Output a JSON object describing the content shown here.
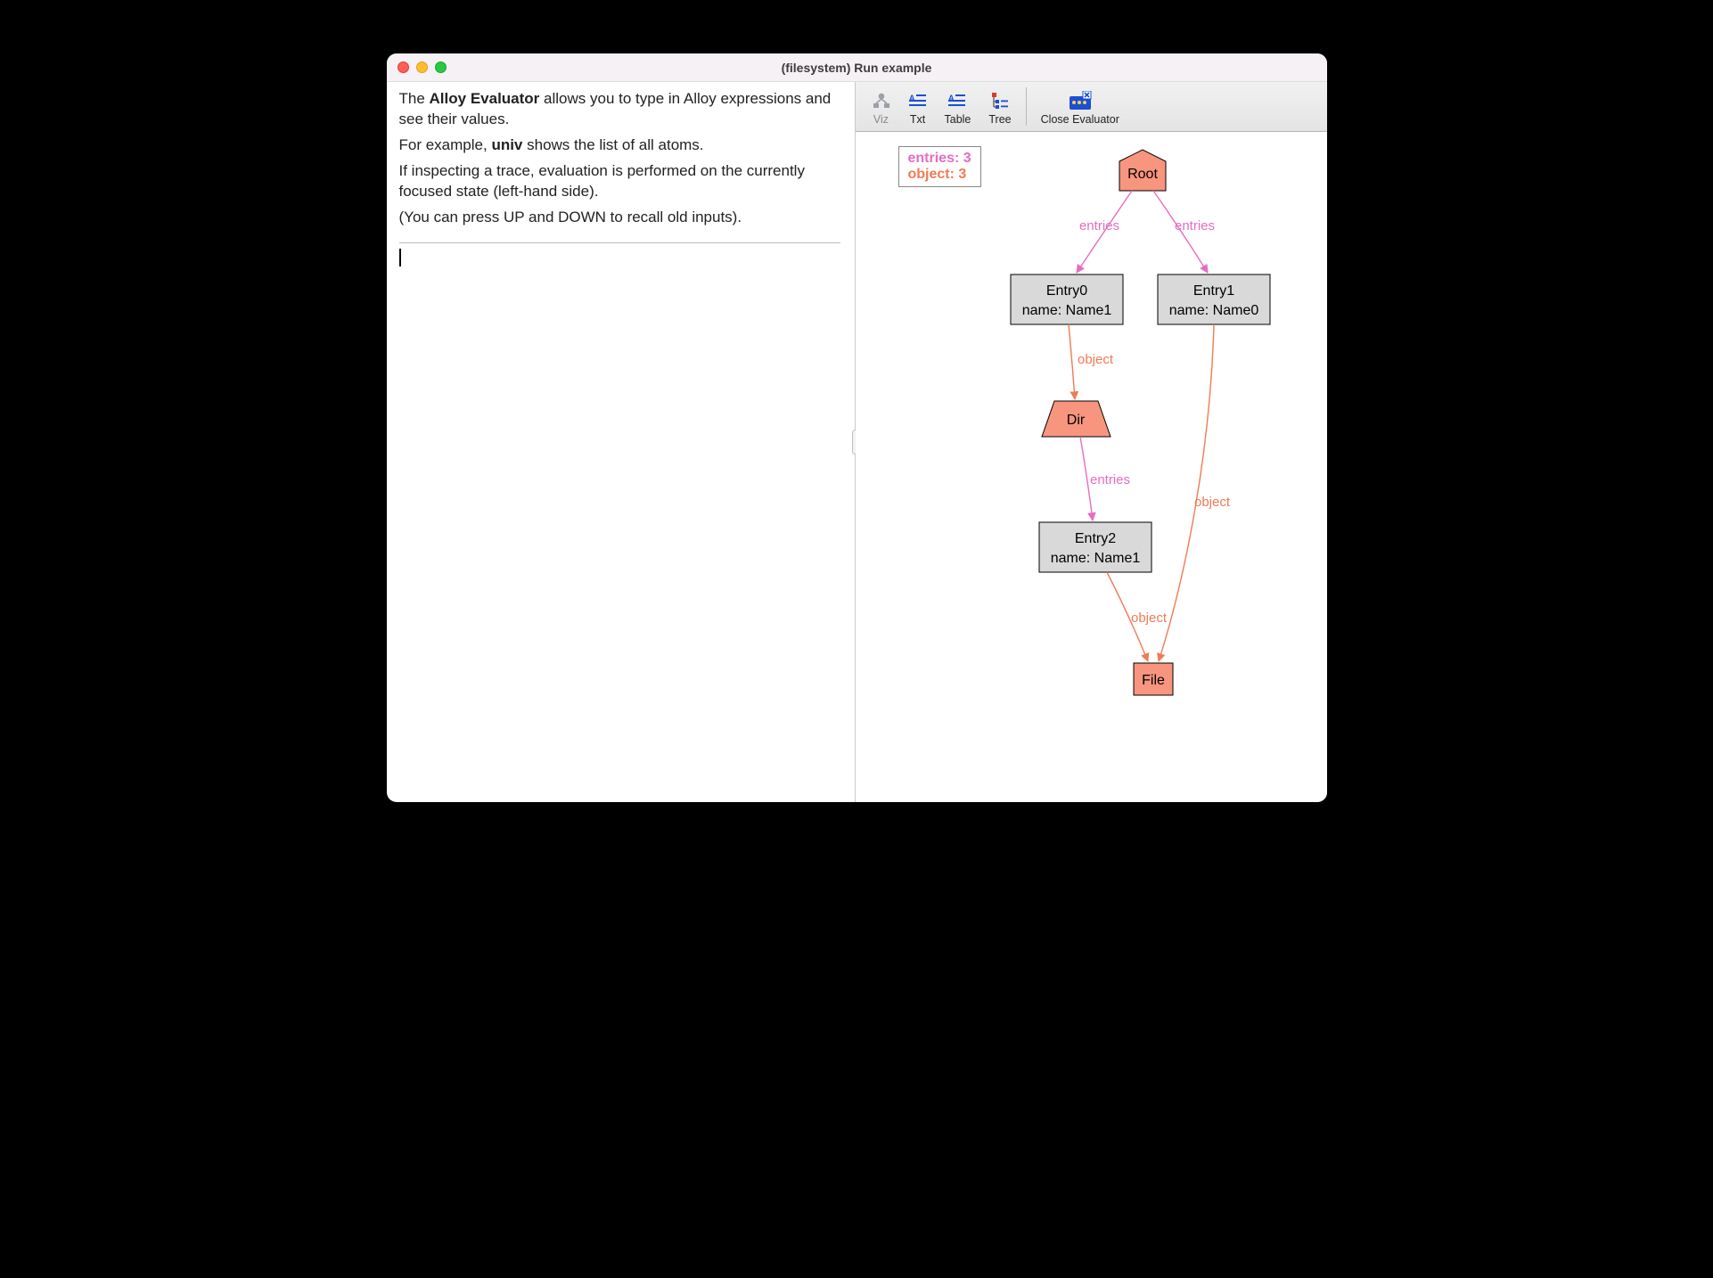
{
  "window": {
    "title": "(filesystem) Run example"
  },
  "evaluator": {
    "intro_prefix": "The ",
    "intro_bold1": "Alloy Evaluator",
    "intro_rest1": " allows you to type in Alloy expressions and see their values.",
    "line2_prefix": "For example, ",
    "line2_bold": "univ",
    "line2_rest": " shows the list of all atoms.",
    "line3": "If inspecting a trace, evaluation is performed on the currently focused state (left-hand side).",
    "line4": "(You can press UP and DOWN to recall old inputs).",
    "input_value": ""
  },
  "toolbar": {
    "viz": "Viz",
    "txt": "Txt",
    "table": "Table",
    "tree": "Tree",
    "close": "Close Evaluator"
  },
  "legend": {
    "entries_label": "entries: 3",
    "object_label": "object: 3"
  },
  "graph": {
    "root": "Root",
    "entry0_title": "Entry0",
    "entry0_sub": "name: Name1",
    "entry1_title": "Entry1",
    "entry1_sub": "name: Name0",
    "dir": "Dir",
    "entry2_title": "Entry2",
    "entry2_sub": "name: Name1",
    "file": "File",
    "edge_entries": "entries",
    "edge_object": "object"
  }
}
